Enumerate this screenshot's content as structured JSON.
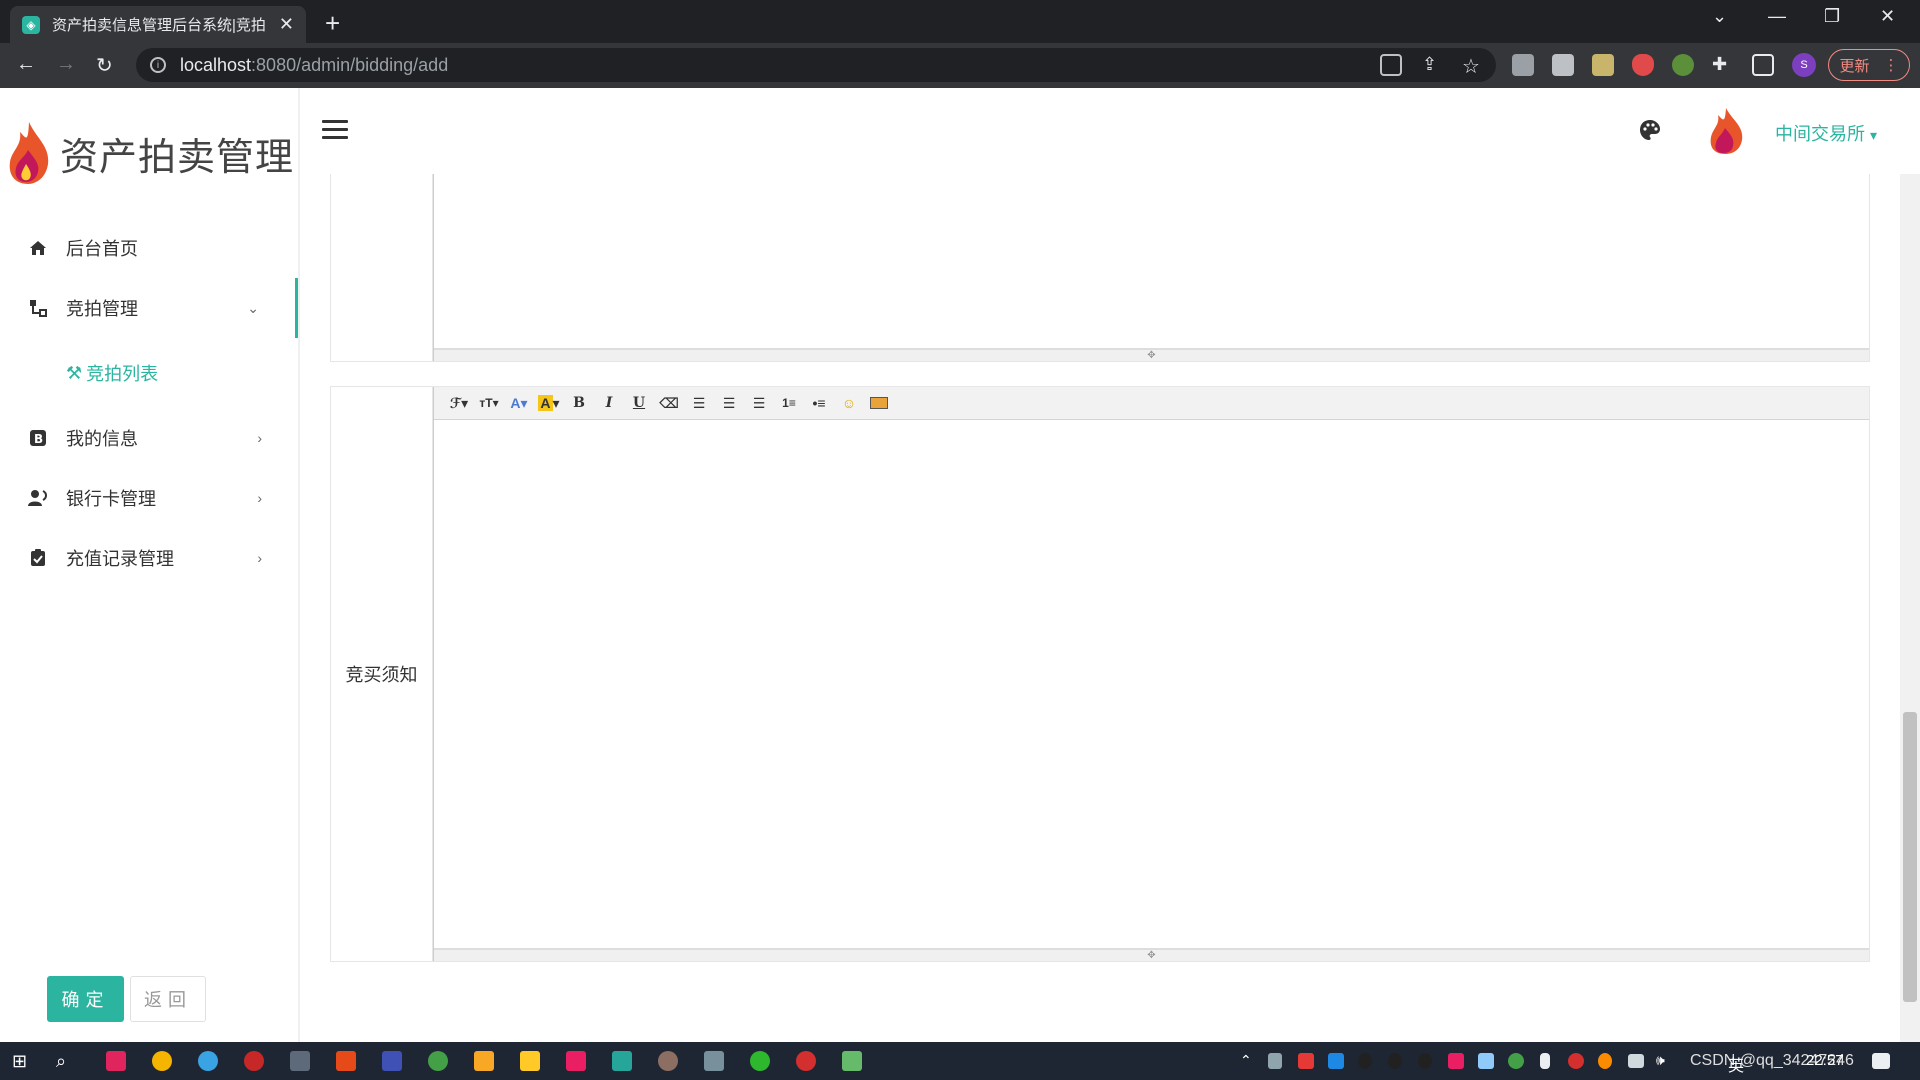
{
  "browser": {
    "tab_title": "资产拍卖信息管理后台系统|竞拍",
    "url_host": "localhost",
    "url_path": ":8080/admin/bidding/add",
    "profile_initial": "S",
    "update_label": "更新"
  },
  "app": {
    "logo_text": "资产拍卖管理",
    "account_name": "中间交易所",
    "account_caret": "▾"
  },
  "sidebar": {
    "items": [
      {
        "label": "后台首页",
        "icon": "home-icon"
      },
      {
        "label": "竞拍管理",
        "icon": "sitemap-icon",
        "arrow": "⌄"
      },
      {
        "label": "我的信息",
        "icon": "bold-b-icon",
        "arrow": "›"
      },
      {
        "label": "银行卡管理",
        "icon": "users-icon",
        "arrow": "›"
      },
      {
        "label": "充值记录管理",
        "icon": "clipboard-check-icon",
        "arrow": "›"
      }
    ],
    "sub_items": [
      {
        "label": "竞拍列表",
        "icon": "gavel-icon"
      }
    ]
  },
  "form": {
    "notice_label": "竞买须知",
    "submit_label": "确定",
    "back_label": "返回"
  },
  "editor_toolbar": [
    "font-family",
    "font-size",
    "font-color",
    "highlight-color",
    "bold",
    "italic",
    "underline",
    "eraser",
    "align-left",
    "align-center",
    "align-right",
    "ordered-list",
    "unordered-list",
    "emoticon",
    "image"
  ],
  "taskbar": {
    "tray_text": "CSDN @qq_34247246",
    "ime": "英",
    "clock": "22:57"
  },
  "colors": {
    "accent": "#2bb5a0",
    "chrome_dark": "#202124",
    "chrome_toolbar": "#35363a"
  }
}
